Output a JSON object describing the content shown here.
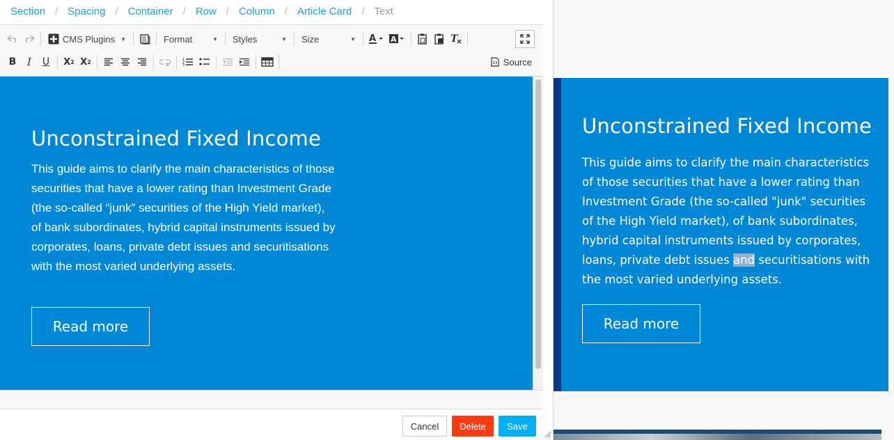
{
  "breadcrumb": [
    "Section",
    "Spacing",
    "Container",
    "Row",
    "Column",
    "Article Card"
  ],
  "breadcrumb_current": "Text",
  "toolbar": {
    "cms_plugins": "CMS Plugins",
    "format": "Format",
    "styles": "Styles",
    "size": "Size",
    "bold": "B",
    "italic": "I",
    "underline": "U",
    "subscript_base": "X",
    "subscript_small": "2",
    "superscript_base": "X",
    "superscript_small": "2",
    "source": "Source"
  },
  "editor_content": {
    "title": "Unconstrained Fixed Income",
    "body": "This guide aims to clarify the main characteristics of those securities that have a lower rating than Investment Grade (the so-called “junk” securities of the High Yield market), of bank subordinates, hybrid capital instruments issued by corporates, loans, private debt issues and securitisations with the most varied underlying assets.",
    "button": "Read more"
  },
  "footer": {
    "cancel": "Cancel",
    "delete": "Delete",
    "save": "Save"
  },
  "preview": {
    "title": "Unconstrained Fixed Income",
    "body_before": "This guide aims to clarify the main characteristics of those securities that have a lower rating than Investment Grade (the so-called \"junk\" securities of the High Yield market), of bank subordinates, hybrid capital instruments issued by corporates, loans, private debt issues ",
    "body_highlight": "and",
    "body_after": " securitisations with the most varied underlying assets.",
    "button": "Read more"
  },
  "colors": {
    "accent_blue": "#0087d6",
    "card_edge": "#0a3a86",
    "link": "#17a1e0",
    "delete": "#ff3b14",
    "save": "#00b0f0"
  }
}
